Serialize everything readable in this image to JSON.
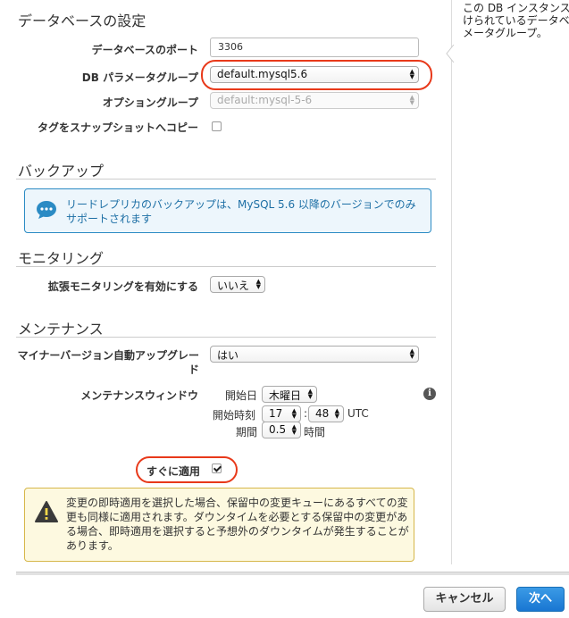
{
  "side_panel": {
    "help_text": "この DB インスタンス\nけられているデータベ\nメータグループ。"
  },
  "db_settings": {
    "title": "データベースの設定",
    "port_label": "データベースのポート",
    "port_value": "3306",
    "param_group_label": "DB パラメータグループ",
    "param_group_value": "default.mysql5.6",
    "option_group_label": "オプショングループ",
    "option_group_value": "default:mysql-5-6",
    "copy_tags_label": "タグをスナップショットへコピー"
  },
  "backup": {
    "title": "バックアップ",
    "info_text": "リードレプリカのバックアップは、MySQL 5.6 以降のバージョンでのみサポートされます"
  },
  "monitoring": {
    "title": "モニタリング",
    "enhanced_label": "拡張モニタリングを有効にする",
    "enhanced_value": "いいえ"
  },
  "maintenance": {
    "title": "メンテナンス",
    "auto_upgrade_label": "マイナーバージョン自動アップグレード",
    "auto_upgrade_value": "はい",
    "window_label": "メンテナンスウィンドウ",
    "start_day_label": "開始日",
    "start_day_value": "木曜日",
    "start_time_label": "開始時刻",
    "start_hour_value": "17",
    "time_separator": ":",
    "start_minute_value": "48",
    "timezone": "UTC",
    "duration_label": "期間",
    "duration_value": "0.5",
    "duration_unit": "時間",
    "info_icon": "i",
    "apply_now_label": "すぐに適用",
    "apply_now_checked": true,
    "warning_text": "変更の即時適用を選択した場合、保留中の変更キューにあるすべての変更も同様に適用されます。ダウンタイムを必要とする保留中の変更がある場合、即時適用を選択すると予想外のダウンタイムが発生することがあります。"
  },
  "footer": {
    "cancel_label": "キャンセル",
    "next_label": "次へ"
  },
  "colors": {
    "highlight": "#e8391a",
    "primary_button": "#1976d2",
    "info_border": "#2b8bc4",
    "warning_border": "#d6b74a"
  }
}
